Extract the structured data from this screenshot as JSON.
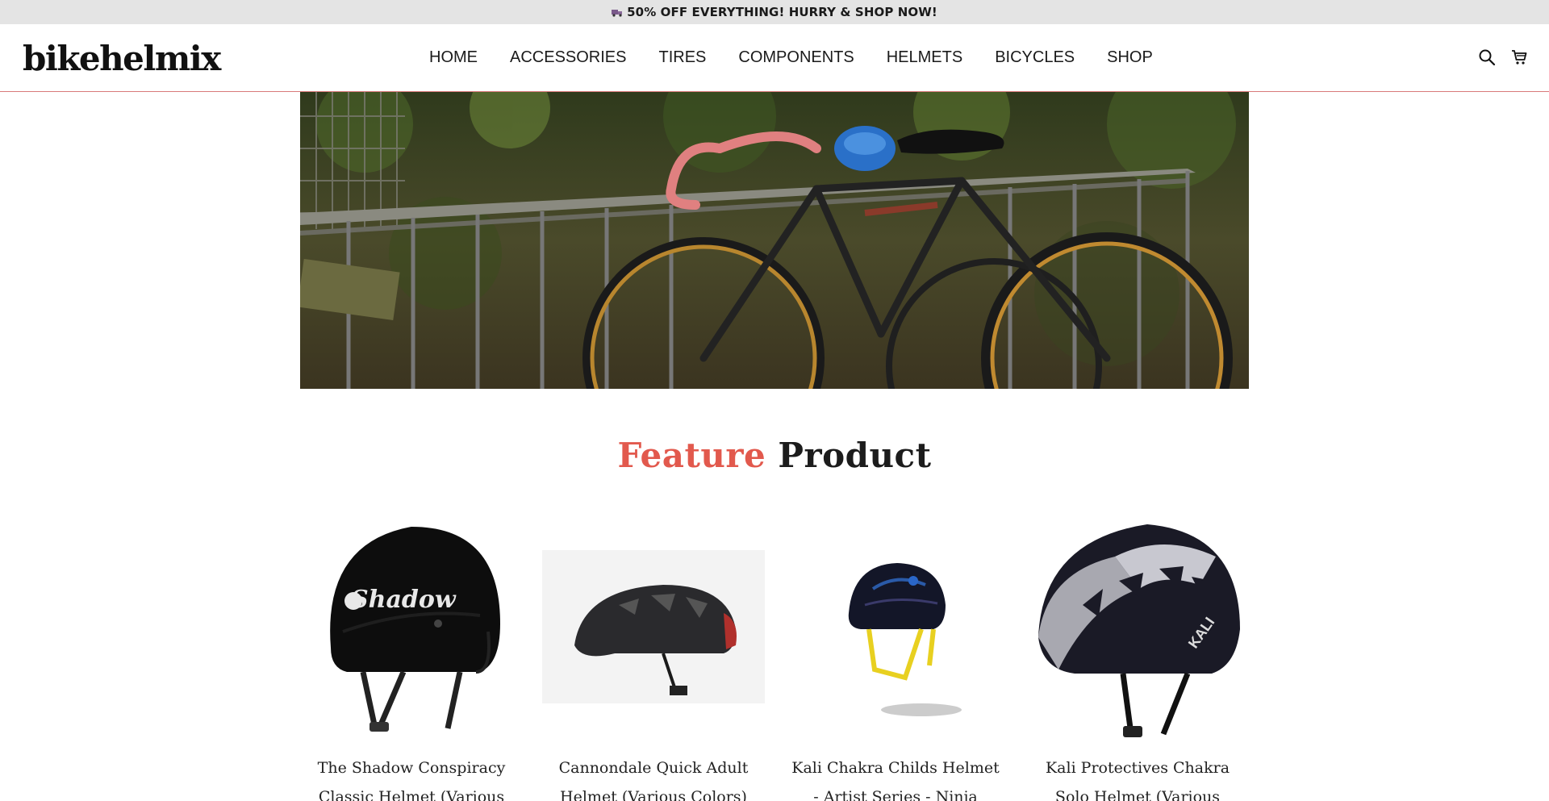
{
  "promo": {
    "text": "50% OFF EVERYTHING! HURRY & SHOP NOW!",
    "icon": "truck-icon"
  },
  "header": {
    "logo": "bikehelmix",
    "nav": [
      {
        "label": "HOME"
      },
      {
        "label": "ACCESSORIES"
      },
      {
        "label": "TIRES"
      },
      {
        "label": "COMPONENTS"
      },
      {
        "label": "HELMETS"
      },
      {
        "label": "BICYCLES"
      },
      {
        "label": "SHOP"
      }
    ],
    "icons": [
      "search-icon",
      "cart-icon"
    ]
  },
  "hero": {
    "image": "bicycles-parked-at-fence"
  },
  "section": {
    "title_accent": "Feature",
    "title_rest": "Product"
  },
  "products": [
    {
      "name": "The Shadow Conspiracy Classic Helmet (Various Sizes)"
    },
    {
      "name": "Cannondale Quick Adult Helmet (Various Colors)"
    },
    {
      "name": "Kali Chakra Childs Helmet - Artist Series - Ninja"
    },
    {
      "name": "Kali Protectives Chakra Solo Helmet (Various Colors)"
    }
  ],
  "colors": {
    "accent": "#e2594d",
    "promo_bg": "#e4e4e4",
    "header_border": "#d97a7a"
  }
}
